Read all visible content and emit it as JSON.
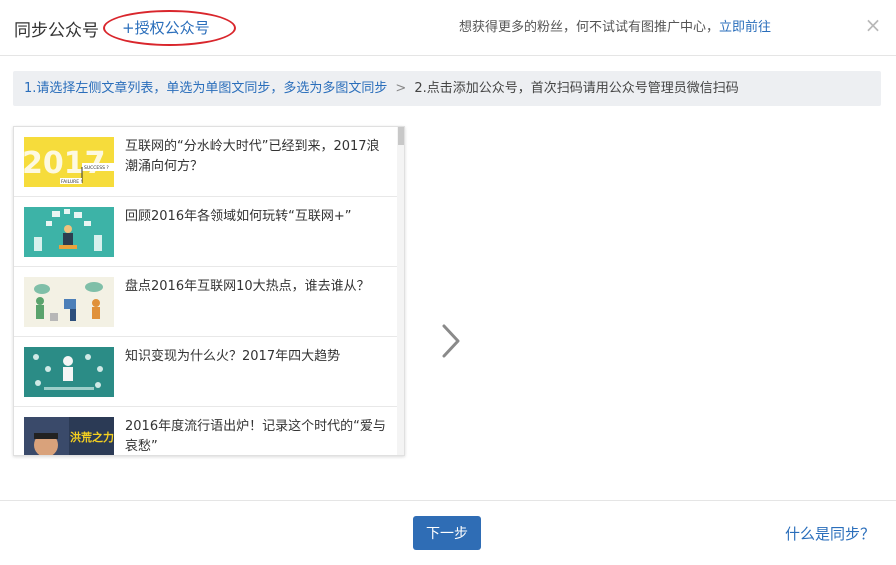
{
  "header": {
    "title": "同步公众号",
    "auth_link": "+授权公众号",
    "promo_text": "想获得更多的粉丝，何不试试有图推广中心，",
    "promo_link": "立即前往",
    "close_icon": "×"
  },
  "steps": {
    "step1": "1.请选择左侧文章列表，单选为单图文同步，多选为多图文同步",
    "separator": ">",
    "step2": "2.点击添加公众号，首次扫码请用公众号管理员微信扫码"
  },
  "articles": [
    {
      "title": "互联网的“分水岭大时代”已经到来，2017浪潮涌向何方？",
      "thumb_year": "2017",
      "thumb_success": "SUCCESS ?",
      "thumb_failure": "FAILURE !"
    },
    {
      "title": "回顾2016年各领域如何玩转“互联网+”"
    },
    {
      "title": "盘点2016年互联网10大热点，谁去谁从？"
    },
    {
      "title": "知识变现为什么火？2017年四大趋势"
    },
    {
      "title": "2016年度流行语出炉！记录这个时代的“爱与哀愁”",
      "thumb_text": "洪荒之力"
    }
  ],
  "footer": {
    "next_button": "下一步",
    "what_is_sync": "什么是同步？"
  },
  "icons": {
    "next_arrow": "chevron-right-icon",
    "close": "close-icon"
  },
  "colors": {
    "link": "#2a6ebb",
    "primary_button": "#2f6db5",
    "highlight_circle": "#d9262c"
  }
}
